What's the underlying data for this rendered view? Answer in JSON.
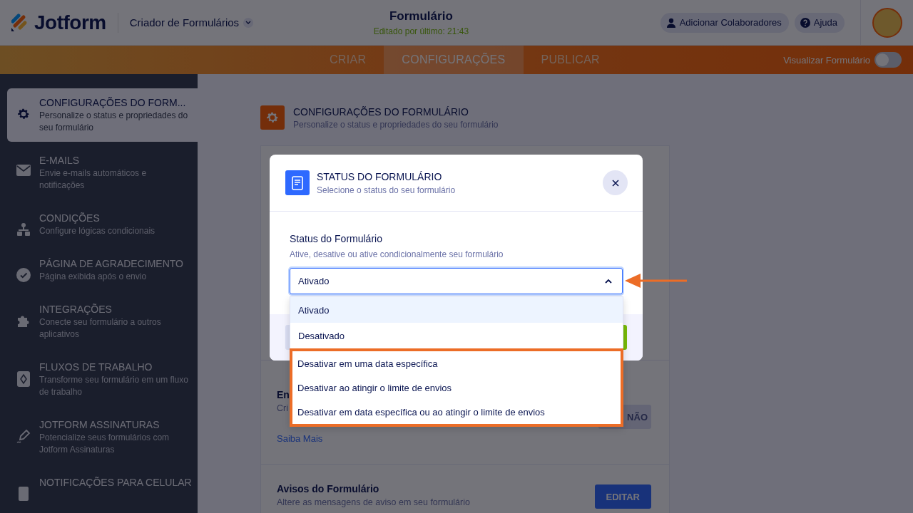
{
  "header": {
    "logo": "Jotform",
    "builder": "Criador de Formulários",
    "title": "Formulário",
    "edited": "Editado por último: 21:43",
    "buttons": [
      {
        "kind": "user",
        "label": "Adicionar Colaboradores"
      },
      {
        "kind": "help",
        "label": "Ajuda"
      }
    ]
  },
  "nav": {
    "tabs": [
      {
        "label": "CRIAR",
        "selected": false
      },
      {
        "label": "CONFIGURAÇÕES",
        "selected": true
      },
      {
        "label": "PUBLICAR",
        "selected": false
      }
    ],
    "preview": {
      "label": "Visualizar Formulário",
      "on": false
    }
  },
  "sidebar": {
    "items": [
      {
        "kind": "settings",
        "title": "CONFIGURAÇÕES DO FORM...",
        "desc": "Personalize o status e propriedades do seu formulário",
        "selected": true
      },
      {
        "kind": "email",
        "title": "E-MAILS",
        "desc": "Envie e-mails automáticos e notificações",
        "selected": false
      },
      {
        "kind": "conditions",
        "title": "CONDIÇÕES",
        "desc": "Configure lógicas condicionais",
        "selected": false
      },
      {
        "kind": "thankyou",
        "title": "PÁGINA DE AGRADECIMENTO",
        "desc": "Página exibida após o envio",
        "selected": false
      },
      {
        "kind": "integrations",
        "title": "INTEGRAÇÕES",
        "desc": "Conecte seu formulário a outros aplicativos",
        "selected": false
      },
      {
        "kind": "workflow",
        "title": "FLUXOS DE TRABALHO",
        "desc": "Transforme seu formulário em um fluxo de trabalho",
        "selected": false
      },
      {
        "kind": "sign",
        "title": "JOTFORM ASSINATURAS",
        "desc": "Potencialize seus formulários com Jotform Assinaturas",
        "selected": false
      },
      {
        "kind": "mobile",
        "title": "NOTIFICAÇÕES PARA CELULAR",
        "selected": false
      }
    ]
  },
  "main": {
    "title": "CONFIGURAÇÕES DO FORMULÁRIO",
    "subtitle": "Personalize o status e propriedades do seu formulário",
    "rows": [
      {
        "title": "En",
        "desc": "Cri",
        "link": "Saiba Mais",
        "button": "NÃO",
        "kind": "toggle"
      },
      {
        "title": "Avisos do Formulário",
        "desc": "Altere as mensagens de aviso em seu formulário",
        "button": "EDITAR",
        "kind": "edit"
      }
    ]
  },
  "modal": {
    "title": "STATUS DO FORMULÁRIO",
    "subtitle": "Selecione o status do seu formulário",
    "label": "Status do Formulário",
    "hint": "Ative, desative ou ative condicionalmente seu formulário",
    "value": "Ativado",
    "options": [
      {
        "label": "Ativado",
        "selected": true,
        "highlighted": false
      },
      {
        "label": "Desativado",
        "selected": false,
        "highlighted": false
      },
      {
        "label": "Desativar em uma data específica",
        "selected": false,
        "highlighted": true
      },
      {
        "label": "Desativar ao atingir o limite de envios",
        "selected": false,
        "highlighted": true
      },
      {
        "label": "Desativar em data específica ou ao atingir o limite de envios",
        "selected": false,
        "highlighted": true
      }
    ]
  }
}
